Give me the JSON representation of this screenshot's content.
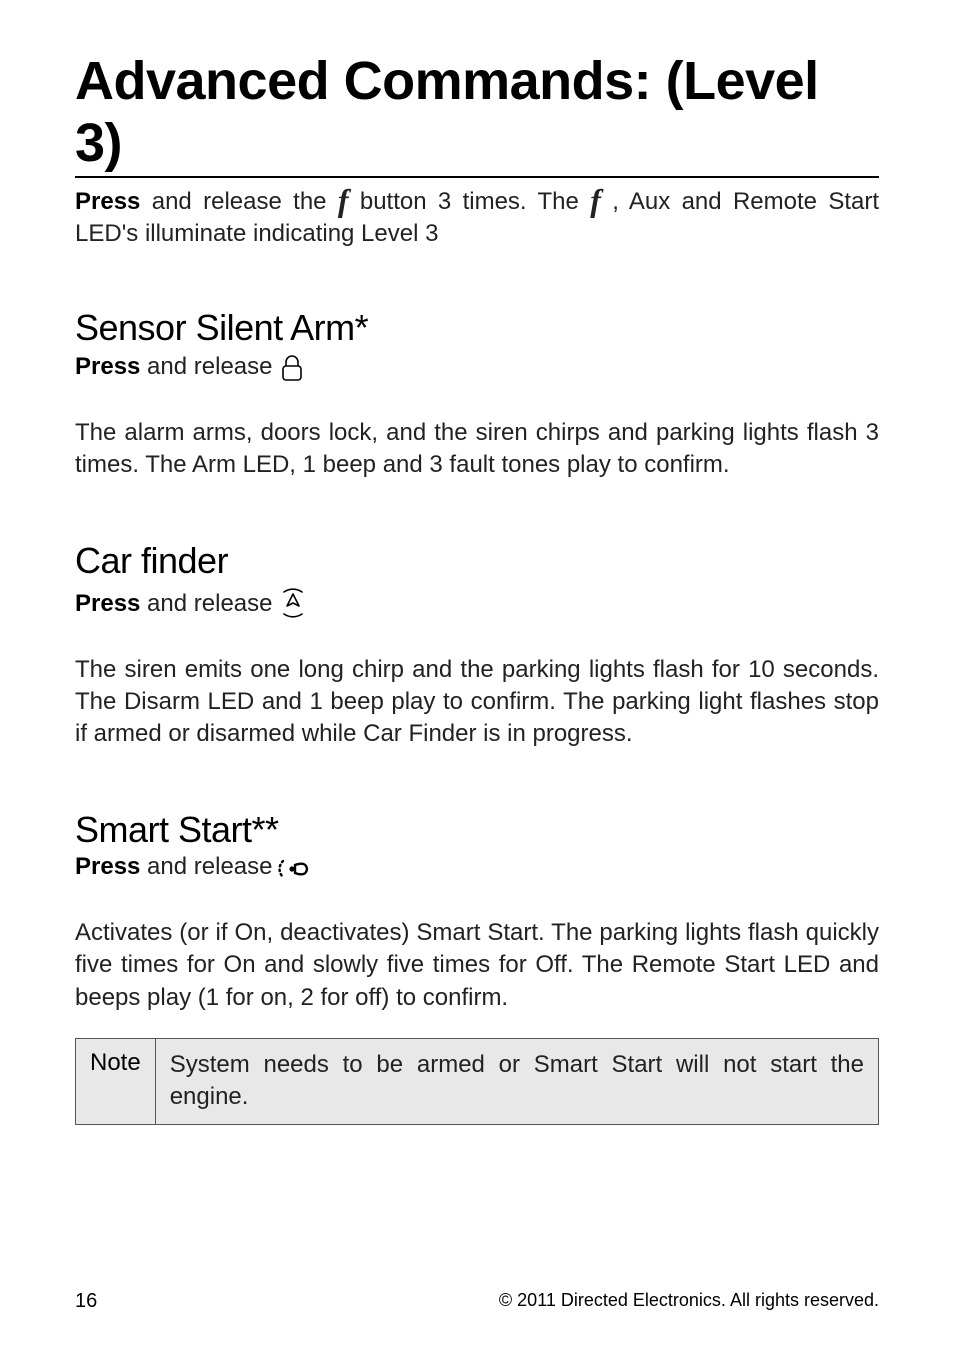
{
  "title": "Advanced Commands: (Level 3)",
  "intro": {
    "press": "Press",
    "part1": " and release the ",
    "f1": "f",
    "part2": " button 3 times. The ",
    "f2": "f",
    "part3": " , Aux and Remote Start LED's illuminate indicating Level 3"
  },
  "sections": {
    "sensor": {
      "heading": "Sensor Silent Arm*",
      "press_bold": "Press",
      "press_rest": " and release",
      "body": "The alarm arms, doors lock, and the siren chirps and parking lights flash 3 times. The Arm LED, 1 beep and 3 fault tones play to confirm."
    },
    "carfinder": {
      "heading": "Car finder",
      "press_bold": "Press",
      "press_rest": " and release",
      "body": "The siren emits one long chirp and the parking lights flash for 10 seconds. The Disarm LED and 1 beep play to confirm. The parking light flashes stop if armed or disarmed while Car Finder is in progress."
    },
    "smartstart": {
      "heading": "Smart Start**",
      "press_bold": "Press",
      "press_rest": " and release",
      "body": "Activates (or if On, deactivates) Smart Start. The parking lights flash quickly five times for On and slowly five times for Off. The Remote Start LED and beeps play (1 for on, 2 for off) to confirm."
    }
  },
  "note": {
    "label": "Note",
    "body": "System needs to be armed or Smart Start will not start the engine."
  },
  "footer": {
    "page": "16",
    "copyright": "© 2011 Directed Electronics. All rights reserved."
  }
}
